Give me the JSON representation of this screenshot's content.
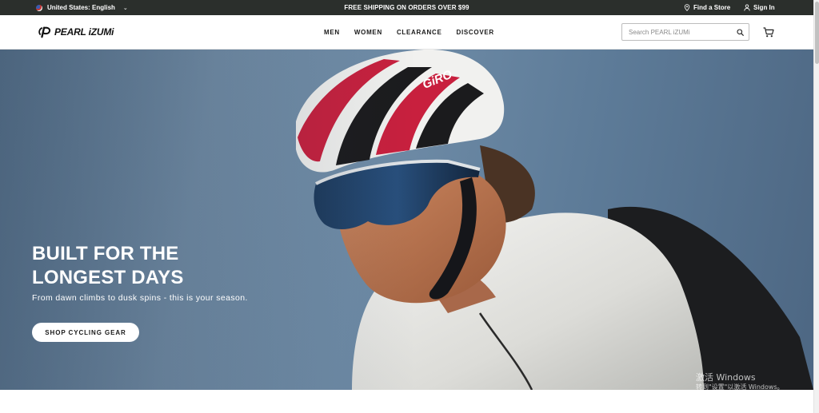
{
  "topbar": {
    "locale_label": "United States: English",
    "promo_text": "FREE SHIPPING ON ORDERS OVER $99",
    "find_store_label": "Find a Store",
    "sign_in_label": "Sign In"
  },
  "header": {
    "logo_text": "PEARL iZUMi",
    "nav": {
      "men": "MEN",
      "women": "WOMEN",
      "clearance": "CLEARANCE",
      "discover": "DISCOVER"
    },
    "search_placeholder": "Search PEARL iZUMi"
  },
  "hero": {
    "title_line1": "BUILT FOR THE",
    "title_line2": "LONGEST DAYS",
    "subtitle": "From dawn climbs to dusk spins - this is your season.",
    "cta_label": "SHOP CYCLING GEAR",
    "helmet_brand_text": "GiRO"
  },
  "watermark": {
    "line1": "激活 Windows",
    "line2": "转到\"设置\"以激活 Windows。"
  },
  "colors": {
    "topbar_bg": "#2b2f2c",
    "hero_sky": "#6f8ca7",
    "helmet_red": "#c8203e",
    "cta_bg": "#ffffff"
  },
  "icons": [
    "us-flag-icon",
    "chevron-down-icon",
    "location-pin-icon",
    "user-icon",
    "search-icon",
    "cart-icon"
  ]
}
